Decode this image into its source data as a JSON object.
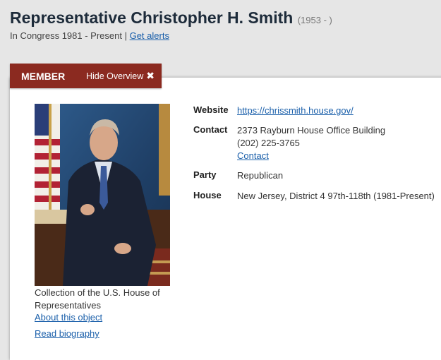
{
  "header": {
    "title": "Representative Christopher H. Smith",
    "years": "(1953 - )",
    "congress_text": "In Congress 1981 - Present |",
    "alerts_link": "Get alerts"
  },
  "tabs": {
    "member": "MEMBER",
    "hide_overview": "Hide Overview"
  },
  "portrait": {
    "caption": "Collection of the U.S. House of Representatives",
    "about_link": "About this object",
    "bio_link": "Read biography"
  },
  "details": {
    "website_label": "Website",
    "website_value": "https://chrissmith.house.gov/",
    "contact_label": "Contact",
    "contact_address": "2373 Rayburn House Office Building",
    "contact_phone": "(202) 225-3765",
    "contact_link": "Contact",
    "party_label": "Party",
    "party_value": "Republican",
    "house_label": "House",
    "house_value": "New Jersey, District 4 97th-118th (1981-Present)"
  },
  "colors": {
    "tab_background": "#8b2a20",
    "link": "#1a5faa",
    "title": "#1d2b3a"
  }
}
